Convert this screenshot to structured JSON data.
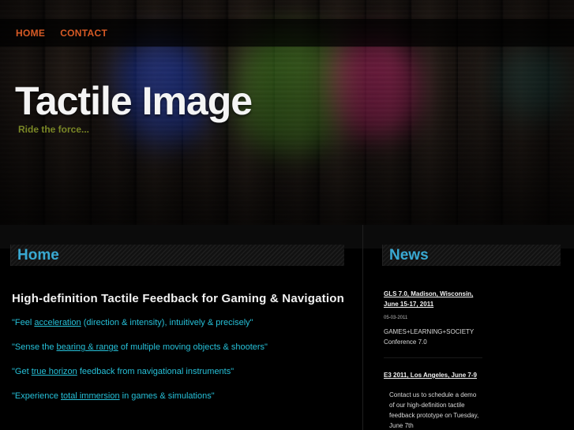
{
  "nav": {
    "home": "HOME",
    "contact": "CONTACT"
  },
  "site": {
    "title": "Tactile Image",
    "tagline": "Ride the force..."
  },
  "main": {
    "section_title": "Home",
    "heading": "High-definition Tactile Feedback for Gaming & Navigation",
    "quotes": [
      {
        "pre": "\"Feel ",
        "link": "acceleration",
        "post": " (direction & intensity), intuitively & precisely\""
      },
      {
        "pre": "\"Sense the ",
        "link": "bearing & range",
        "post": " of multiple moving objects & shooters\""
      },
      {
        "pre": "\"Get ",
        "link": "true horizon",
        "post": " feedback from navigational instruments\""
      },
      {
        "pre": "\"Experience ",
        "link": "total immersion",
        "post": " in games & simulations\""
      }
    ]
  },
  "news": {
    "section_title": "News",
    "items": [
      {
        "title": "GLS 7.0, Madison, Wisconsin, June 15-17, 2011",
        "date": "05-03-2011",
        "text": "GAMES+LEARNING+SOCIETY Conference 7.0"
      },
      {
        "title": "E3 2011, Los Angeles, June 7-9",
        "text": "Contact us to schedule a demo of our high-definition tactile feedback prototype on Tuesday, June 7th"
      }
    ]
  },
  "colors": {
    "nav_link": "#d75a25",
    "tagline": "#7a8726",
    "section_title": "#39a9d2",
    "quote_text": "#26c0d8"
  }
}
